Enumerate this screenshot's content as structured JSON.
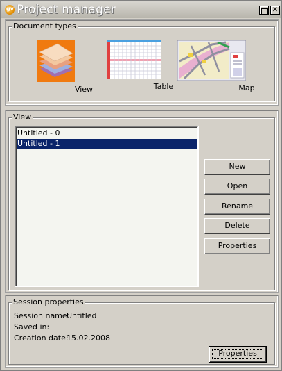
{
  "window": {
    "title": "Project manager",
    "app_icon_letters": "gv"
  },
  "doc_types": {
    "legend": "Document types",
    "items": [
      {
        "label": "View",
        "icon": "view-layers-icon"
      },
      {
        "label": "Table",
        "icon": "table-grid-icon"
      },
      {
        "label": "Map",
        "icon": "map-icon"
      }
    ]
  },
  "view": {
    "legend": "View",
    "list": [
      "Untitled - 0",
      "Untitled - 1"
    ],
    "selected_index": 1,
    "buttons": {
      "new": "New",
      "open": "Open",
      "rename": "Rename",
      "delete": "Delete",
      "properties": "Properties"
    }
  },
  "session": {
    "legend": "Session properties",
    "name_label": "Session name:",
    "name_value": "Untitled",
    "saved_label": "Saved in:",
    "saved_value": "",
    "date_label": "Creation date:",
    "date_value": "15.02.2008",
    "properties_button": "Properties"
  },
  "colors": {
    "face": "#d4d0c8",
    "selection": "#0a246a",
    "list_bg": "#f4f5f0"
  }
}
